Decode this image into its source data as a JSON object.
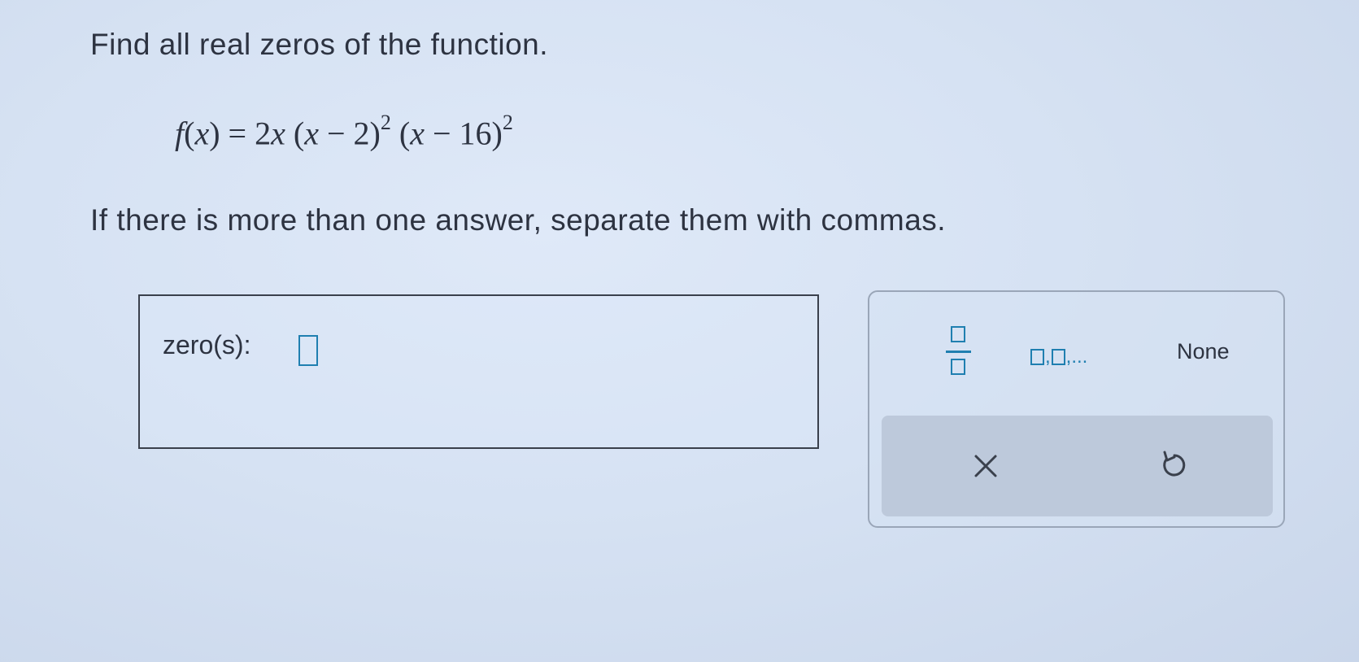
{
  "question": {
    "prompt": "Find all real zeros of the function.",
    "equation": {
      "fname": "f",
      "lparen": "(",
      "var": "x",
      "rparen_eq": ") = 2",
      "factor1_open": " (",
      "factor1_var": "x",
      "factor1_rest": " − 2)",
      "factor1_exp": "2",
      "factor2_open": " (",
      "factor2_var": "x",
      "factor2_rest": " − 16)",
      "factor2_exp": "2"
    },
    "instruction": "If there is more than one answer, separate them with commas."
  },
  "answer": {
    "label": "zero(s):",
    "value": ""
  },
  "toolbar": {
    "fraction_icon": "fraction-template-icon",
    "list_icon": "comma-list-template-icon",
    "list_suffix": ",...",
    "none_label": "None",
    "clear_symbol": "×",
    "undo_icon": "undo-icon"
  },
  "colors": {
    "accent": "#1f7fb0",
    "text": "#2d3341",
    "action_bar": "#bdc9db"
  }
}
